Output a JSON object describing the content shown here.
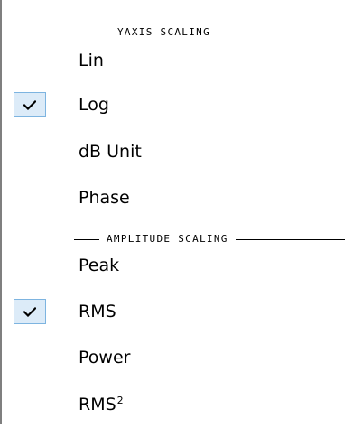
{
  "sections": [
    {
      "header": "YAXIS SCALING",
      "items": [
        {
          "label": "Lin",
          "checked": false
        },
        {
          "label": "Log",
          "checked": true
        },
        {
          "label": "dB Unit",
          "checked": false
        },
        {
          "label": "Phase",
          "checked": false
        }
      ]
    },
    {
      "header": "AMPLITUDE SCALING",
      "items": [
        {
          "label": "Peak",
          "checked": false
        },
        {
          "label": "RMS",
          "checked": true
        },
        {
          "label": "Power",
          "checked": false
        },
        {
          "label": "RMS",
          "superscript": "2",
          "checked": false
        }
      ]
    }
  ],
  "icons": {
    "check": "checkmark-icon"
  },
  "colors": {
    "check_background": "#dcebf8",
    "check_border": "#7db4e0"
  }
}
